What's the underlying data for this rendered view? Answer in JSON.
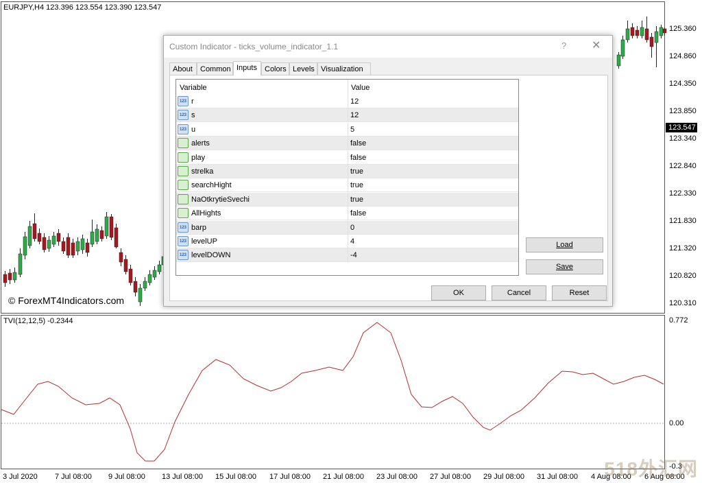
{
  "chart": {
    "title": "EURJPY,H4  123.396 123.554 123.390 123.547",
    "watermark": "© ForexMT4Indicators.com",
    "price_labels": [
      "125.360",
      "124.860",
      "124.350",
      "123.850",
      "123.340",
      "122.840",
      "122.330",
      "121.830",
      "121.320",
      "120.820",
      "120.310"
    ],
    "current_price": "123.547",
    "bull_color": "#2eaa49",
    "bear_color": "#a21a1f"
  },
  "indicator": {
    "title": "TVI(12,12,5) -0.2344",
    "scale_labels": [
      "0.772",
      "0.00",
      "-0.3"
    ],
    "line_color": "#b03030"
  },
  "dates": [
    "3 Jul 2020",
    "7 Jul 08:00",
    "9 Jul 08:00",
    "13 Jul 08:00",
    "15 Jul 08:00",
    "17 Jul 08:00",
    "21 Jul 08:00",
    "23 Jul 08:00",
    "27 Jul 08:00",
    "29 Jul 08:00",
    "31 Jul 08:00",
    "4 Aug 08:00",
    "6 Aug 08:00"
  ],
  "site_logo": "518外汇网",
  "dialog": {
    "title": "Custom Indicator - ticks_volume_indicator_1.1",
    "help_label": "?",
    "close_label": "✕",
    "tabs": [
      {
        "label": "About",
        "active": false
      },
      {
        "label": "Common",
        "active": false
      },
      {
        "label": "Inputs",
        "active": true
      },
      {
        "label": "Colors",
        "active": false
      },
      {
        "label": "Levels",
        "active": false
      },
      {
        "label": "Visualization",
        "active": false
      }
    ],
    "grid": {
      "col_variable": "Variable",
      "col_value": "Value",
      "rows": [
        {
          "name": "r",
          "value": "12",
          "icon": "number-icon",
          "icon_text": "123"
        },
        {
          "name": "s",
          "value": "12",
          "icon": "number-icon",
          "icon_text": "123"
        },
        {
          "name": "u",
          "value": "5",
          "icon": "number-icon",
          "icon_text": "123"
        },
        {
          "name": "alerts",
          "value": "false",
          "icon": "boolean-icon",
          "icon_text": ""
        },
        {
          "name": "play",
          "value": "false",
          "icon": "boolean-icon",
          "icon_text": ""
        },
        {
          "name": "strelka",
          "value": "true",
          "icon": "boolean-icon",
          "icon_text": ""
        },
        {
          "name": "searchHight",
          "value": "true",
          "icon": "boolean-icon",
          "icon_text": ""
        },
        {
          "name": "NaOtkrytieSvechi",
          "value": "true",
          "icon": "boolean-icon",
          "icon_text": ""
        },
        {
          "name": "AllHights",
          "value": "false",
          "icon": "boolean-icon",
          "icon_text": ""
        },
        {
          "name": "barp",
          "value": "0",
          "icon": "number-icon",
          "icon_text": "123"
        },
        {
          "name": "levelUP",
          "value": "4",
          "icon": "number-icon",
          "icon_text": "123"
        },
        {
          "name": "levelDOWN",
          "value": "-4",
          "icon": "number-icon",
          "icon_text": "123"
        }
      ]
    },
    "buttons": {
      "load": "Load",
      "save": "Save",
      "ok": "OK",
      "cancel": "Cancel",
      "reset": "Reset"
    }
  }
}
